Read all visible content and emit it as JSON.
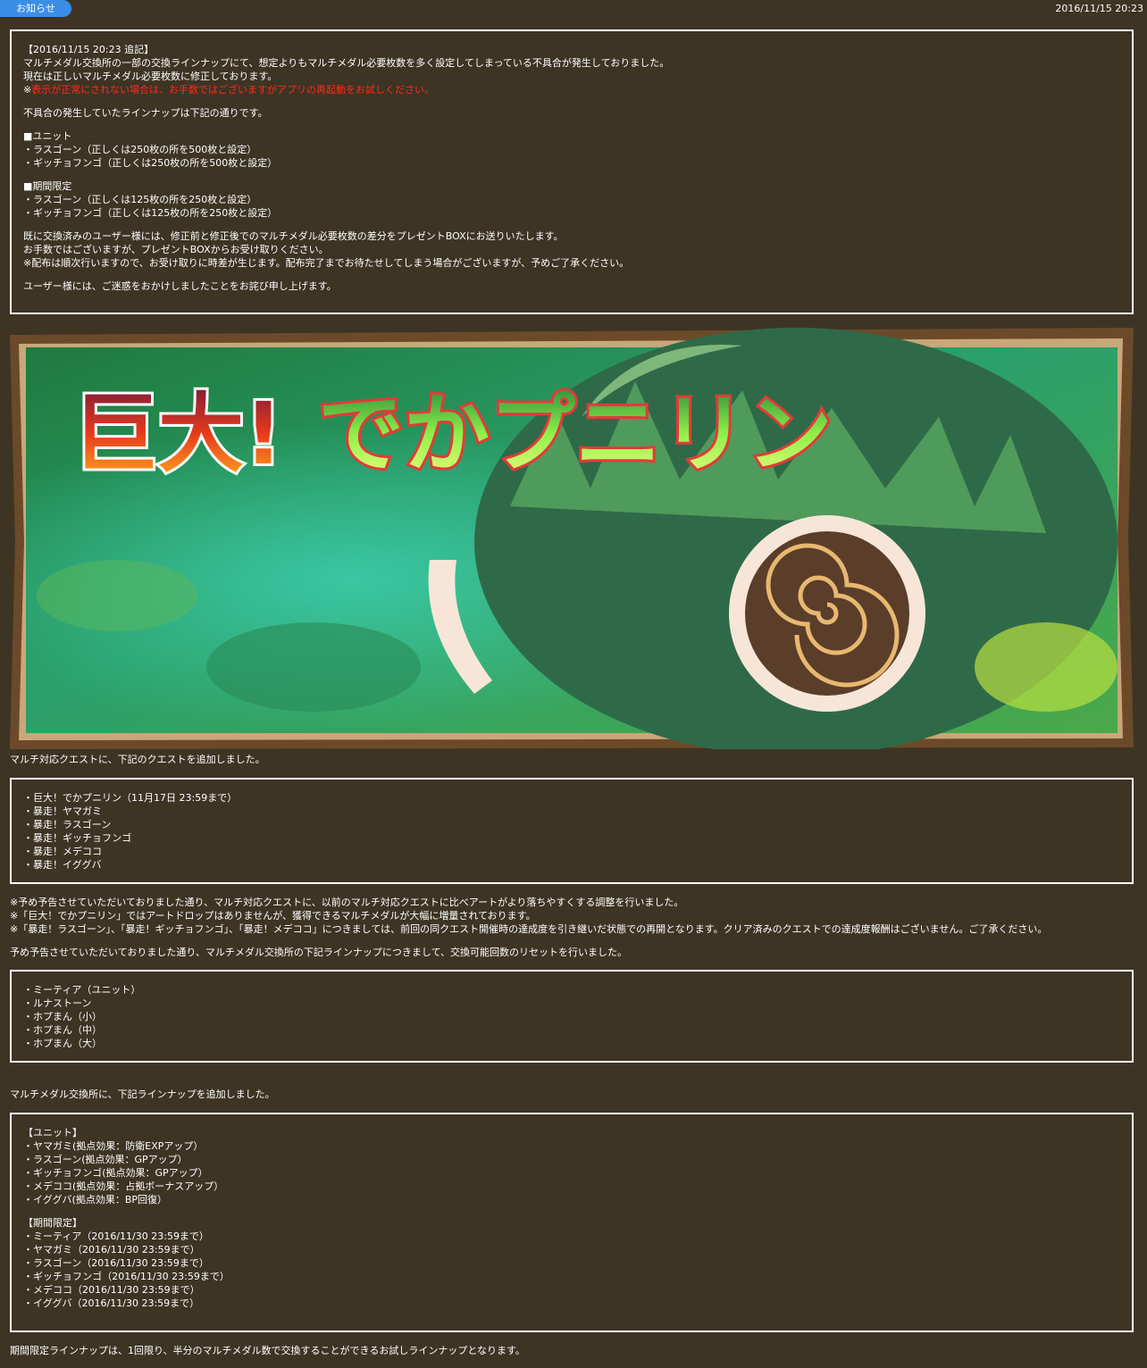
{
  "header": {
    "tag_label": "お知らせ",
    "date": "2016/11/15 20:23"
  },
  "notice": {
    "heading": "【2016/11/15 20:23 追記】",
    "intro": [
      "マルチメダル交換所の一部の交換ラインナップにて、想定よりもマルチメダル必要枚数を多く設定してしまっている不具合が発生しておりました。",
      "現在は正しいマルチメダル必要枚数に修正しております。"
    ],
    "warning_prefix": "※",
    "warning": "表示が正常にされない場合は、お手数ではございますがアプリの再起動をお試しください。",
    "lineup_intro": "不具合の発生していたラインナップは下記の通りです。",
    "unit_heading": "■ユニット",
    "unit_items": [
      "・ラスゴーン（正しくは250枚の所を500枚と設定）",
      "・ギッチョフンゴ（正しくは250枚の所を500枚と設定）"
    ],
    "limited_heading": "■期間限定",
    "limited_items": [
      "・ラスゴーン（正しくは125枚の所を250枚と設定）",
      "・ギッチョフンゴ（正しくは125枚の所を250枚と設定）"
    ],
    "compensation": [
      "既に交換済みのユーザー様には、修正前と修正後でのマルチメダル必要枚数の差分をプレゼントBOXにお送りいたします。",
      "お手数ではございますが、プレゼントBOXからお受け取りください。",
      "※配布は順次行いますので、お受け取りに時差が生じます。配布完了までお待たせしてしまう場合がございますが、予めご了承ください。"
    ],
    "apology": "ユーザー様には、ご迷惑をおかけしましたことをお詫び申し上げます。"
  },
  "banner": {
    "title_part1": "巨大!",
    "title_part2": "でかプニリン",
    "colors": {
      "frame": "#6b4a2a",
      "green": "#2f8f4a",
      "title_red": "#e84a1c",
      "title_green": "#8ff04a"
    }
  },
  "quests": {
    "intro": "マルチ対応クエストに、下記のクエストを追加しました。",
    "items": [
      "・巨大！でかプニリン（11月17日 23:59まで）",
      "・暴走！ヤマガミ",
      "・暴走！ラスゴーン",
      "・暴走！ギッチョフンゴ",
      "・暴走！メデココ",
      "・暴走！イググバ"
    ],
    "notes": [
      "※予め予告させていただいておりました通り、マルチ対応クエストに、以前のマルチ対応クエストに比べアートがより落ちやすくする調整を行いました。",
      "※「巨大！でかプニリン」ではアートドロップはありませんが、獲得できるマルチメダルが大幅に増量されております。",
      "※「暴走！ラスゴーン」、「暴走！ギッチョフンゴ」、「暴走！メデココ」につきましては、前回の同クエスト開催時の達成度を引き継いだ状態での再開となります。クリア済みのクエストでの達成度報酬はございません。ご了承ください。"
    ]
  },
  "reset": {
    "intro": "予め予告させていただいておりました通り、マルチメダル交換所の下記ラインナップにつきまして、交換可能回数のリセットを行いました。",
    "items": [
      "・ミーティア（ユニット）",
      "・ルナストーン",
      "・ホプまん（小）",
      "・ホプまん（中）",
      "・ホプまん（大）"
    ]
  },
  "exchange": {
    "intro": "マルチメダル交換所に、下記ラインナップを追加しました。",
    "unit_heading": "【ユニット】",
    "unit_items": [
      "・ヤマガミ(拠点効果：防衛EXPアップ）",
      "・ラスゴーン(拠点効果：GPアップ）",
      "・ギッチョフンゴ(拠点効果：GPアップ）",
      "・メデココ(拠点効果：占拠ボーナスアップ）",
      "・イググバ(拠点効果：BP回復）"
    ],
    "limited_heading": "【期間限定】",
    "limited_items": [
      "・ミーティア（2016/11/30 23:59まで）",
      "・ヤマガミ（2016/11/30 23:59まで）",
      "・ラスゴーン（2016/11/30 23:59まで）",
      "・ギッチョフンゴ（2016/11/30 23:59まで）",
      "・メデココ（2016/11/30 23:59まで）",
      "・イググバ（2016/11/30 23:59まで）"
    ],
    "footer": "期間限定ラインナップは、1回限り、半分のマルチメダル数で交換することができるお試しラインナップとなります。"
  }
}
